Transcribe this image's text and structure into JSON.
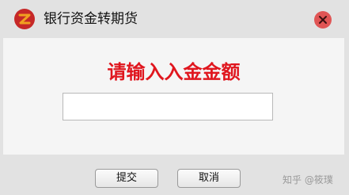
{
  "window": {
    "title": "银行资金转期货",
    "logo_icon": "brand-logo-icon",
    "close_icon": "close-icon"
  },
  "dialog": {
    "prompt": "请输入入金金额",
    "amount_input": {
      "value": "",
      "placeholder": ""
    }
  },
  "buttons": {
    "submit_label": "提交",
    "cancel_label": "取消"
  },
  "watermark": "知乎 @筱璞",
  "colors": {
    "prompt": "#e0161e",
    "close_button": "#e05555",
    "logo_primary": "#c62828",
    "logo_secondary": "#f0a020",
    "background": "#e2e2e2",
    "content_background": "#f5f5f5"
  }
}
